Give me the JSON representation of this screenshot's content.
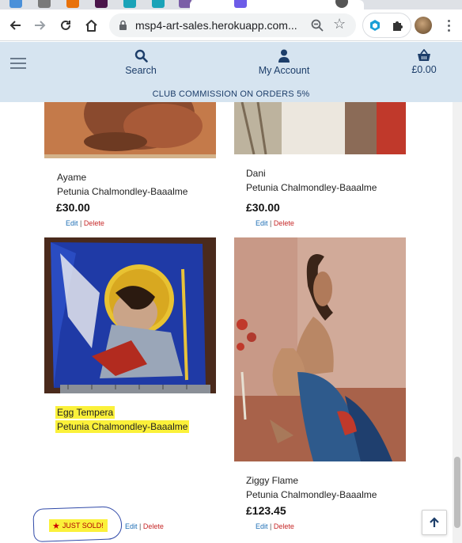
{
  "browser": {
    "url": "msp4-art-sales.herokuapp.com..."
  },
  "header": {
    "nav": {
      "search_label": "Search",
      "account_label": "My Account",
      "bag_total": "£0.00"
    },
    "banner": "CLUB COMMISSION ON ORDERS 5%"
  },
  "products": [
    {
      "title": "Ayame",
      "artist": "Petunia Chalmondley-Baaalme",
      "price": "£30.00",
      "edit_label": "Edit",
      "separator": "|",
      "delete_label": "Delete"
    },
    {
      "title": "Dani",
      "artist": "Petunia Chalmondley-Baaalme",
      "price": "£30.00",
      "edit_label": "Edit",
      "separator": "|",
      "delete_label": "Delete"
    },
    {
      "title": "Egg Tempera",
      "artist": "Petunia Chalmondley-Baaalme",
      "sold_label": "JUST SOLD!",
      "edit_label": "Edit",
      "separator": "|",
      "delete_label": "Delete"
    },
    {
      "title": "Ziggy Flame",
      "artist": "Petunia Chalmondley-Baaalme",
      "price": "£123.45",
      "edit_label": "Edit",
      "separator": "|",
      "delete_label": "Delete"
    }
  ],
  "colors": {
    "header_bg": "#d6e4f0",
    "nav_text": "#1d3e6a",
    "edit_link": "#1e6fb5",
    "delete_link": "#c62828",
    "highlight": "#fbf13a"
  },
  "icons": [
    "back-arrow-icon",
    "forward-arrow-icon",
    "reload-icon",
    "home-icon",
    "lock-icon",
    "zoom-icon",
    "bookmark-star-icon",
    "hamburger-icon",
    "search-icon",
    "user-icon",
    "basket-icon",
    "star-icon",
    "arrow-up-icon"
  ]
}
